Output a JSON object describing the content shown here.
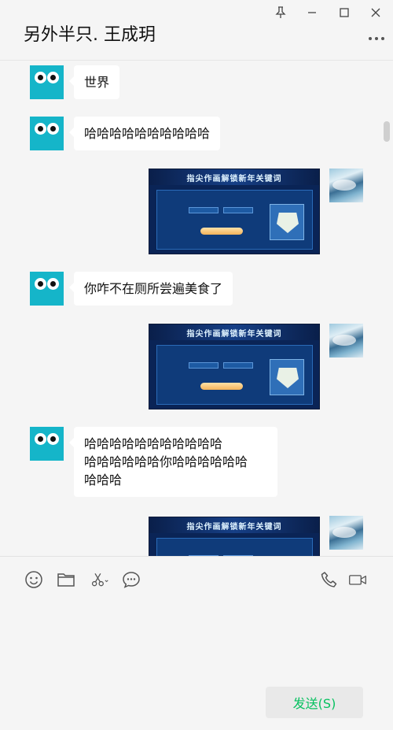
{
  "window": {
    "title": "另外半只. 王成玥"
  },
  "messages": [
    {
      "side": "left",
      "type": "text",
      "text": "世界"
    },
    {
      "side": "left",
      "type": "text",
      "text": "哈哈哈哈哈哈哈哈哈哈"
    },
    {
      "side": "right",
      "type": "image",
      "banner": "指尖作画解锁新年关键词"
    },
    {
      "side": "left",
      "type": "text",
      "text": "你咋不在厕所尝遍美食了"
    },
    {
      "side": "right",
      "type": "image",
      "banner": "指尖作画解锁新年关键词"
    },
    {
      "side": "left",
      "type": "text",
      "lines": [
        "哈哈哈哈哈哈哈哈哈哈哈",
        "哈哈哈哈哈哈你哈哈哈哈哈哈",
        "哈哈哈"
      ]
    },
    {
      "side": "right",
      "type": "image",
      "banner": "指尖作画解锁新年关键词"
    }
  ],
  "toolbar": {
    "icons": [
      "emoji-icon",
      "folder-icon",
      "scissors-icon",
      "chat-history-icon",
      "phone-icon",
      "video-icon"
    ]
  },
  "compose": {
    "value": ""
  },
  "send_button": {
    "label": "发送(S)"
  },
  "colors": {
    "accent": "#07c160",
    "avatar": "#15b5c9",
    "background": "#f5f5f5"
  }
}
